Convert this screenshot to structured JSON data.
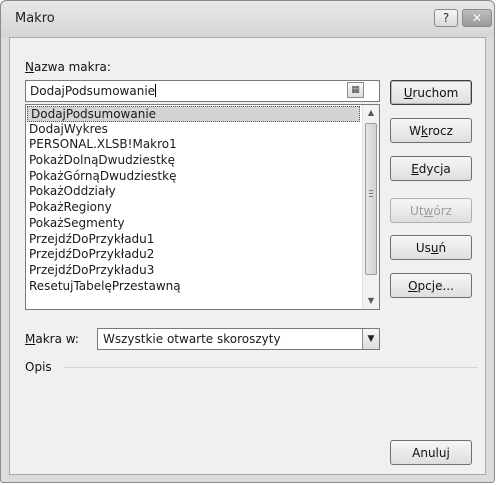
{
  "window": {
    "title": "Makro",
    "help_glyph": "?",
    "close_glyph": "✕"
  },
  "name_label": "Nazwa makra:",
  "name_value": "DodajPodsumowanie",
  "macros": [
    "DodajPodsumowanie",
    "DodajWykres",
    "PERSONAL.XLSB!Makro1",
    "PokażDolnąDwudziestkę",
    "PokażGórnąDwudziestkę",
    "PokażOddziały",
    "PokażRegiony",
    "PokażSegmenty",
    "PrzejdźDoPrzykładu1",
    "PrzejdźDoPrzykładu2",
    "PrzejdźDoPrzykładu3",
    "ResetujTabelęPrzestawną"
  ],
  "selected_macro": "DodajPodsumowanie",
  "buttons": {
    "run": "Uruchom",
    "step_into": "Wkrocz",
    "edit": "Edycja",
    "create": "Utwórz",
    "delete": "Usuń",
    "options": "Opcje...",
    "cancel": "Anuluj"
  },
  "macros_in_label": "Makra w:",
  "macros_in_value": "Wszystkie otwarte skoroszyty",
  "description_label": "Opis",
  "description_value": ""
}
